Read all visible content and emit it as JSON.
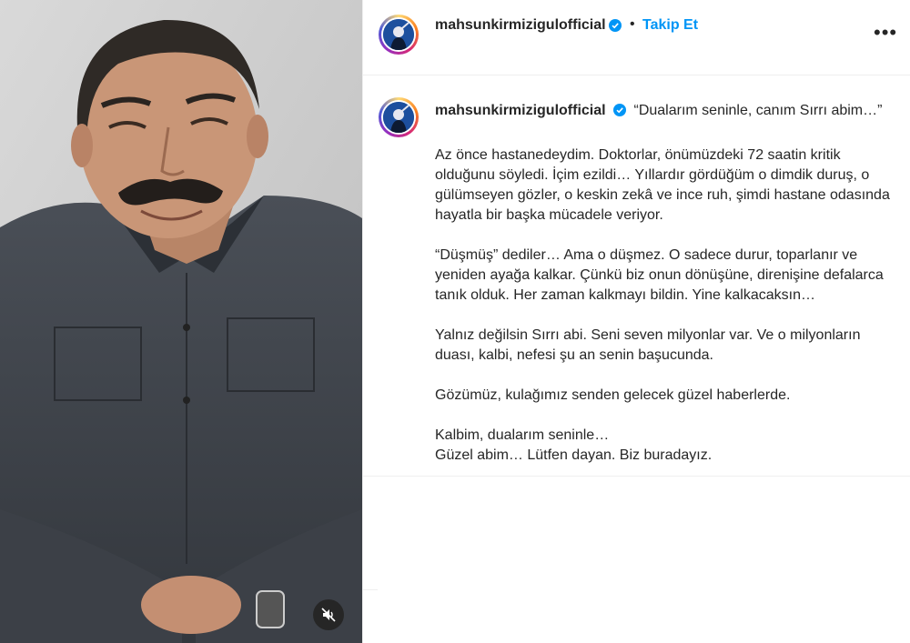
{
  "post": {
    "username": "mahsunkirmizigulofficial",
    "follow_label": "Takip Et",
    "separator": "•",
    "more_icon": "more-horizontal-icon",
    "caption_quote": "“Dualarım seninle, canım Sırrı abim…”",
    "caption_paragraphs": [
      "Az önce hastanedeydim. Doktorlar, önümüzdeki 72 saatin kritik olduğunu söyledi. İçim ezildi… Yıllardır gördüğüm o dimdik duruş, o gülümseyen gözler, o keskin zekâ ve ince ruh, şimdi hastane odasında hayatla bir başka mücadele veriyor.",
      "“Düşmüş” dediler… Ama o düşmez. O sadece durur, toparlanır ve yeniden ayağa kalkar. Çünkü biz onun dönüşüne, direnişine defalarca tanık olduk. Her zaman kalkmayı bildin. Yine kalkacaksın…",
      "Yalnız değilsin Sırrı abi. Seni seven milyonlar var. Ve o milyonların duası, kalbi, nefesi şu an senin başucunda.",
      "Gözümüz, kulağımız senden gelecek güzel haberlerde.",
      "Kalbim, dualarım seninle…\nGüzel abim… Lütfen dayan. Biz buradayız."
    ]
  },
  "icons": {
    "verified": "verified-badge-icon",
    "mute": "audio-muted-icon"
  },
  "colors": {
    "link_blue": "#0095f6",
    "verified_blue": "#0095f6",
    "text": "#262626"
  }
}
